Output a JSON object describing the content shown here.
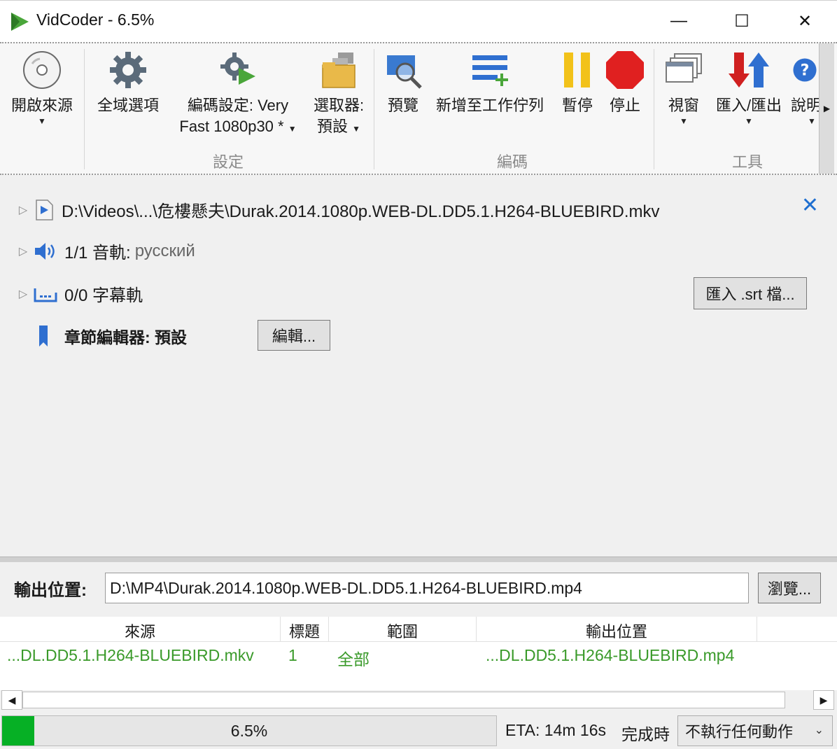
{
  "window": {
    "title": "VidCoder - 6.5%",
    "minimize": "—",
    "maximize": "☐",
    "close": "✕"
  },
  "ribbon": {
    "open_source": "開啟來源",
    "global_options": "全域選項",
    "encode_settings_line1": "編碼設定: Very",
    "encode_settings_line2": "Fast 1080p30 *",
    "picker_line1": "選取器:",
    "picker_line2": "預設",
    "group_settings": "設定",
    "preview": "預覽",
    "add_to_queue": "新增至工作佇列",
    "pause": "暫停",
    "stop": "停止",
    "group_encode": "編碼",
    "windows": "視窗",
    "import_export": "匯入/匯出",
    "help": "說明",
    "group_tools": "工具"
  },
  "source": {
    "path": "D:\\Videos\\...\\危樓懸夫\\Durak.2014.1080p.WEB-DL.DD5.1.H264-BLUEBIRD.mkv",
    "audio_count": "1/1 音軌:",
    "audio_lang": "русский",
    "subtitle_count": "0/0 字幕軌",
    "import_srt": "匯入 .srt 檔...",
    "chapter_label": "章節編輯器: 預設",
    "edit_button": "編輯..."
  },
  "output": {
    "label": "輸出位置:",
    "path": "D:\\MP4\\Durak.2014.1080p.WEB-DL.DD5.1.H264-BLUEBIRD.mp4",
    "browse": "瀏覽..."
  },
  "queue": {
    "headers": [
      "來源",
      "標題",
      "範圍",
      "輸出位置"
    ],
    "rows": [
      {
        "source": "...DL.DD5.1.H264-BLUEBIRD.mkv",
        "title": "1",
        "range": "全部",
        "output": "...DL.DD5.1.H264-BLUEBIRD.mp4"
      }
    ]
  },
  "status": {
    "progress_text": "6.5%",
    "progress_value": 0.065,
    "eta": "ETA: 14m 16s",
    "when_done_label": "完成時",
    "when_done_value": "不執行任何動作"
  },
  "colors": {
    "progress": "#06b025",
    "queue_text": "#3a9a2a",
    "accent_blue": "#1f6fd0",
    "stop_red": "#e02020",
    "pause_yellow": "#f2c21a"
  }
}
